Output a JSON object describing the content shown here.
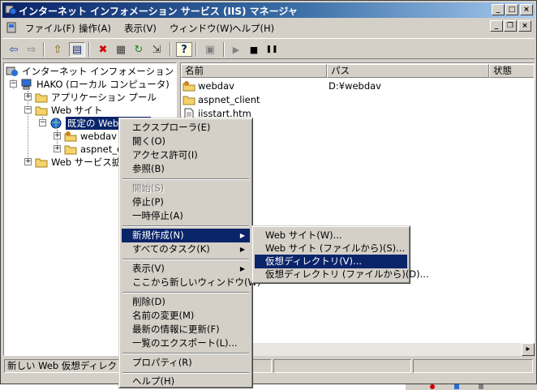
{
  "window": {
    "title": "インターネット インフォメーション サービス (IIS) マネージャ"
  },
  "caption_buttons": {
    "minimize": "_",
    "maximize": "□",
    "close": "×"
  },
  "mdi_buttons": {
    "minimize": "_",
    "restore": "❐",
    "close": "×"
  },
  "menubar": [
    "ファイル(F)",
    "操作(A)",
    "表示(V)",
    "ウィンドウ(W)",
    "ヘルプ(H)"
  ],
  "toolbar": {
    "icons": [
      "back-arrow-icon",
      "forward-arrow-icon",
      "up-folder-icon",
      "show-tree-icon",
      "delete-icon",
      "properties-icon",
      "refresh-icon",
      "export-icon",
      "help-icon",
      "computer-icon",
      "play-icon",
      "stop-icon",
      "pause-icon"
    ],
    "glyphs": {
      "back": "⇦",
      "forward": "⇨",
      "up": "⇧",
      "tree": "▤",
      "delete": "✖",
      "props": "▦",
      "refresh": "↻",
      "export": "⇲",
      "help": "?",
      "computer": "▣",
      "play": "▶",
      "stop": "■",
      "pause": "❚❚"
    }
  },
  "tree": {
    "expand_plus": "+",
    "expand_minus": "−",
    "root": "インターネット インフォメーション サービス",
    "server": "HAKO (ローカル コンピュータ)",
    "app_pools": "アプリケーション プール",
    "web_sites": "Web サイト",
    "default_site": "既定の Web サイト",
    "webdav": "webdav",
    "aspnet": "aspnet_client",
    "ext": "Web サービス拡張"
  },
  "list": {
    "columns": [
      "名前",
      "パス",
      "状態"
    ],
    "rows": [
      {
        "name": "webdav",
        "path": "D:¥webdav",
        "icon": "virtual-dir-icon"
      },
      {
        "name": "aspnet_client",
        "path": "",
        "icon": "folder-icon"
      },
      {
        "name": "iisstart.htm",
        "path": "",
        "icon": "document-icon"
      }
    ]
  },
  "context_menu": {
    "group1": [
      "エクスプローラ(E)",
      "開く(O)",
      "アクセス許可(I)",
      "参照(B)"
    ],
    "group2": [
      "開始(S)",
      "停止(P)",
      "一時停止(A)"
    ],
    "group3": [
      "新規作成(N)",
      "すべてのタスク(K)"
    ],
    "group4": [
      "表示(V)",
      "ここから新しいウィンドウ(W)"
    ],
    "group5": [
      "削除(D)",
      "名前の変更(M)",
      "最新の情報に更新(F)",
      "一覧のエクスポート(L)..."
    ],
    "group6": [
      "プロパティ(R)"
    ],
    "group7": [
      "ヘルプ(H)"
    ],
    "arrow": "▶"
  },
  "submenu": [
    "Web サイト(W)...",
    "Web サイト (ファイルから)(S)...",
    "仮想ディレクトリ(V)...",
    "仮想ディレクトリ (ファイルから)(D)..."
  ],
  "status": {
    "text": "新しい Web 仮想ディレクトリを作成します。"
  },
  "scroll": {
    "right": "▸"
  },
  "colors": {
    "title_start": "#0a246a",
    "title_end": "#a6caf0",
    "selection": "#0a246a",
    "face": "#d4d0c8"
  }
}
